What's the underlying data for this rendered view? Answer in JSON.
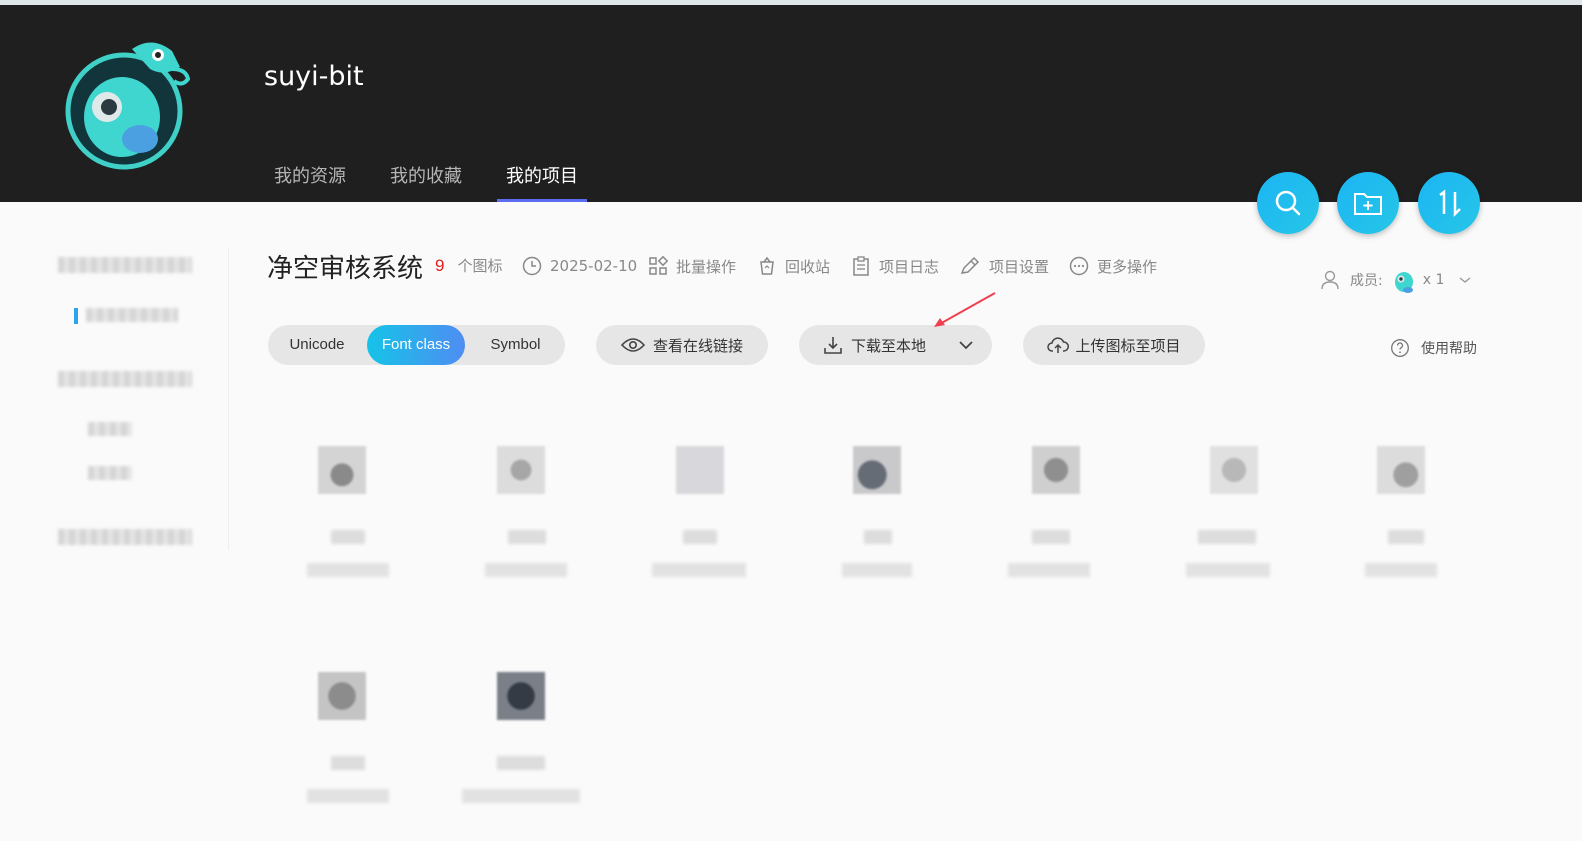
{
  "user": {
    "name": "suyi-bit"
  },
  "nav": {
    "tabs": [
      {
        "label": "我的资源"
      },
      {
        "label": "我的收藏"
      },
      {
        "label": "我的项目"
      }
    ]
  },
  "fab": {
    "icons": [
      "search-icon",
      "new-folder-icon",
      "sort-icon"
    ]
  },
  "project": {
    "title": "净空审核系统",
    "icon_count": "9",
    "icon_count_unit": "个图标",
    "date": "2025-02-10",
    "actions": {
      "batch": "批量操作",
      "recycle": "回收站",
      "log": "项目日志",
      "settings": "项目设置",
      "more": "更多操作"
    },
    "members": {
      "label": "成员:",
      "count": "x 1"
    }
  },
  "toolbar": {
    "segments": [
      {
        "label": "Unicode"
      },
      {
        "label": "Font class"
      },
      {
        "label": "Symbol"
      }
    ],
    "active_segment": "Font class",
    "view_online": "查看在线链接",
    "download": "下载至本地",
    "upload": "上传图标至项目",
    "help": "使用帮助"
  },
  "colors": {
    "accent": "#1bb5f5",
    "count_red": "#e02020",
    "tab_underline": "#5b6cf0"
  }
}
